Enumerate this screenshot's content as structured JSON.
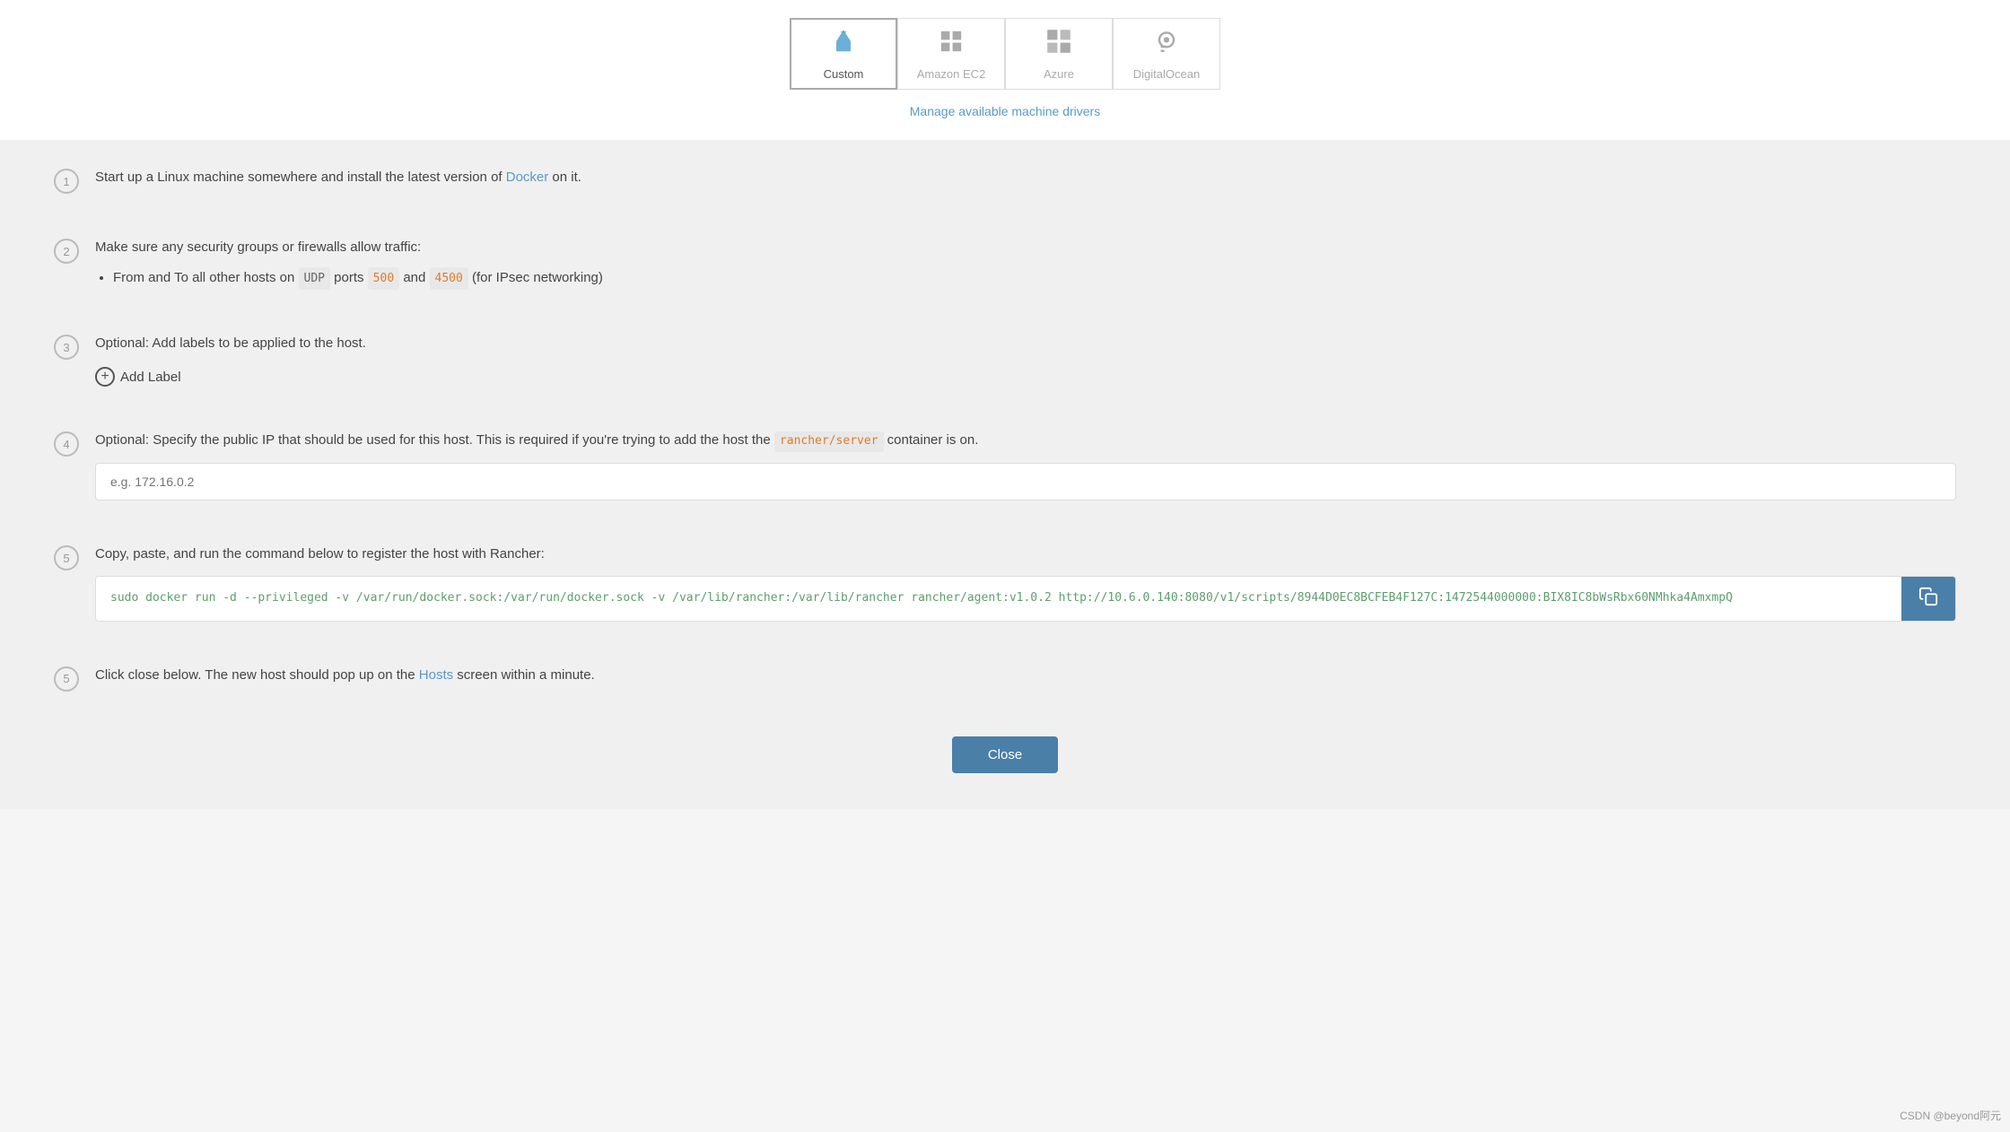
{
  "tabs": [
    {
      "id": "custom",
      "label": "Custom",
      "active": true
    },
    {
      "id": "amazon-ec2",
      "label": "Amazon EC2",
      "active": false
    },
    {
      "id": "azure",
      "label": "Azure",
      "active": false
    },
    {
      "id": "digitalocean",
      "label": "DigitalOcean",
      "active": false
    }
  ],
  "manage_link": "Manage available machine drivers",
  "steps": [
    {
      "number": "1",
      "text_before": "Start up a Linux machine somewhere and install the latest version of ",
      "link_text": "Docker",
      "text_after": " on it."
    },
    {
      "number": "2",
      "text": "Make sure any security groups or firewalls allow traffic:",
      "sub_item": "From and To all other hosts on ",
      "udp_badge": "UDP",
      "text_ports": " ports ",
      "port1": "500",
      "text_and": " and ",
      "port2": "4500",
      "text_ipsec": " (for IPsec networking)"
    },
    {
      "number": "3",
      "text": "Optional: Add labels to be applied to the host.",
      "add_label_btn": "Add Label"
    },
    {
      "number": "4",
      "text_before": "Optional: Specify the public IP that should be used for this host. This is required if you're trying to add the host the ",
      "code_badge": "rancher/server",
      "text_after": " container is on.",
      "placeholder": "e.g. 172.16.0.2"
    },
    {
      "number": "5",
      "text": "Copy, paste, and run the command below to register the host with Rancher:",
      "command": "sudo docker run -d --privileged -v /var/run/docker.sock:/var/run/docker.sock -v /var/lib/rancher:/var/lib/rancher rancher/agent:v1.0.2 http://10.6.0.140:8080/v1/scripts/8944D0EC8BCFEB4F127C:1472544000000:BIX8IC8bWsRbx60NMhka4AmxmpQ",
      "copy_icon": "📋"
    },
    {
      "number": "5",
      "text_before": "Click close below. The new host should pop up on the ",
      "link_text": "Hosts",
      "text_after": " screen within a minute."
    }
  ],
  "close_button_label": "Close",
  "watermark": "CSDN @beyond阿元"
}
